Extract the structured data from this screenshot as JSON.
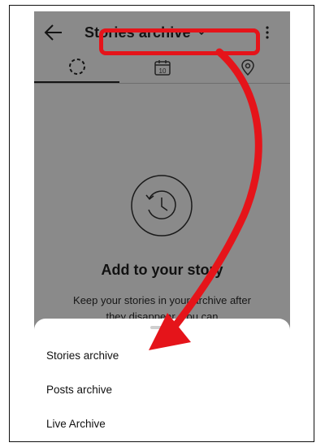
{
  "appbar": {
    "title": "Stories archive",
    "back_icon": "arrow-left-icon",
    "caret_icon": "chevron-down-icon",
    "more_icon": "more-vertical-icon"
  },
  "tabs": [
    {
      "icon": "stories-ring-icon",
      "active": true
    },
    {
      "icon": "calendar-icon",
      "calendar_day": "10",
      "active": false
    },
    {
      "icon": "location-pin-icon",
      "active": false
    }
  ],
  "empty_state": {
    "icon": "history-clock-icon",
    "title": "Add to your story",
    "body": "Keep your stories in your archive after they disappear. You can"
  },
  "sheet": {
    "items": [
      {
        "label": "Stories archive"
      },
      {
        "label": "Posts archive"
      },
      {
        "label": "Live Archive"
      }
    ]
  },
  "annotation": {
    "color": "#e5141a"
  }
}
